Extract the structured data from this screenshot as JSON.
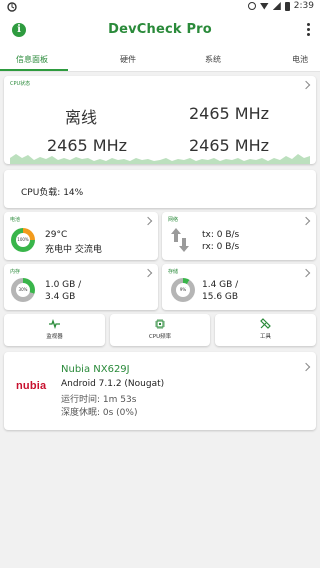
{
  "status_bar": {
    "time": "2:39"
  },
  "app": {
    "title": "DevCheck Pro",
    "info_glyph": "i"
  },
  "tabs": [
    {
      "label": "信息面板"
    },
    {
      "label": "硬件"
    },
    {
      "label": "系统"
    },
    {
      "label": "电池"
    }
  ],
  "cpu_card": {
    "title": "CPU状态",
    "values": [
      "离线",
      "2465 MHz",
      "2465 MHz",
      "2465 MHz"
    ]
  },
  "cpu_load": {
    "label": "CPU负载: 14%"
  },
  "battery": {
    "title": "电池",
    "level_percent": 100,
    "ring_label": "100%",
    "temperature": "29°C",
    "status": "充电中 交流电",
    "ring_color": "#f29b1c"
  },
  "network": {
    "title": "网络",
    "tx": "tx: 0 B/s",
    "rx": "rx: 0 B/s"
  },
  "memory": {
    "title": "内存",
    "ring_label": "30%",
    "level_percent": 30,
    "used": "1.0 GB /",
    "total": "3.4 GB"
  },
  "storage": {
    "title": "存储",
    "ring_label": "9%",
    "level_percent": 9,
    "used": "1.4 GB /",
    "total": "15.6 GB"
  },
  "buttons": [
    {
      "label": "监视器",
      "icon": "monitor-icon"
    },
    {
      "label": "CPU频率",
      "icon": "cpu-icon"
    },
    {
      "label": "工具",
      "icon": "tools-icon"
    }
  ],
  "device": {
    "logo": "nubia",
    "name": "Nubia NX629J",
    "os": "Android 7.1.2 (Nougat)",
    "uptime": "运行时间: 1m 53s",
    "deep_sleep": "深度休眠: 0s (0%)"
  },
  "colors": {
    "accent": "#2e9b3f",
    "brand": "#c8102e"
  }
}
